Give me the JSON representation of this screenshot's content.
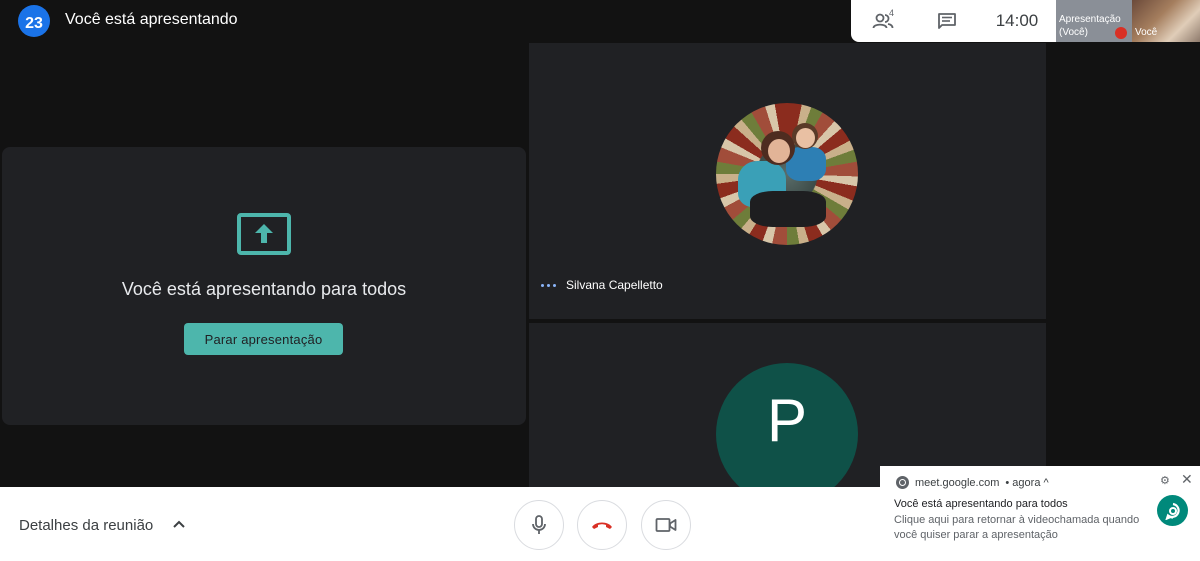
{
  "calendar": {
    "day": "23",
    "month": ""
  },
  "header": {
    "title": "Você está apresentando"
  },
  "top_panel": {
    "people_count": "4",
    "clock": "14:00",
    "presentation_thumb_label_line1": "Apresentação",
    "presentation_thumb_label_line2": "(Você)",
    "self_thumb_label": "Você"
  },
  "present_card": {
    "message": "Você está apresentando para todos",
    "stop_button_label": "Parar apresentação"
  },
  "participants": [
    {
      "name": "Silvana Capelletto",
      "avatar": "photo"
    },
    {
      "name": "",
      "initial": "P"
    }
  ],
  "bottom_bar": {
    "details_label": "Detalhes da reunião"
  },
  "notification": {
    "source": "meet.google.com",
    "time": "• agora ^",
    "title": "Você está apresentando para todos",
    "body": "Clique aqui para retornar à videochamada quando você quiser parar a apresentação"
  },
  "colors": {
    "accent": "#4db6ac",
    "end_call": "#d93025",
    "avatar_p": "#0f5148",
    "calendar": "#1a73e8"
  }
}
